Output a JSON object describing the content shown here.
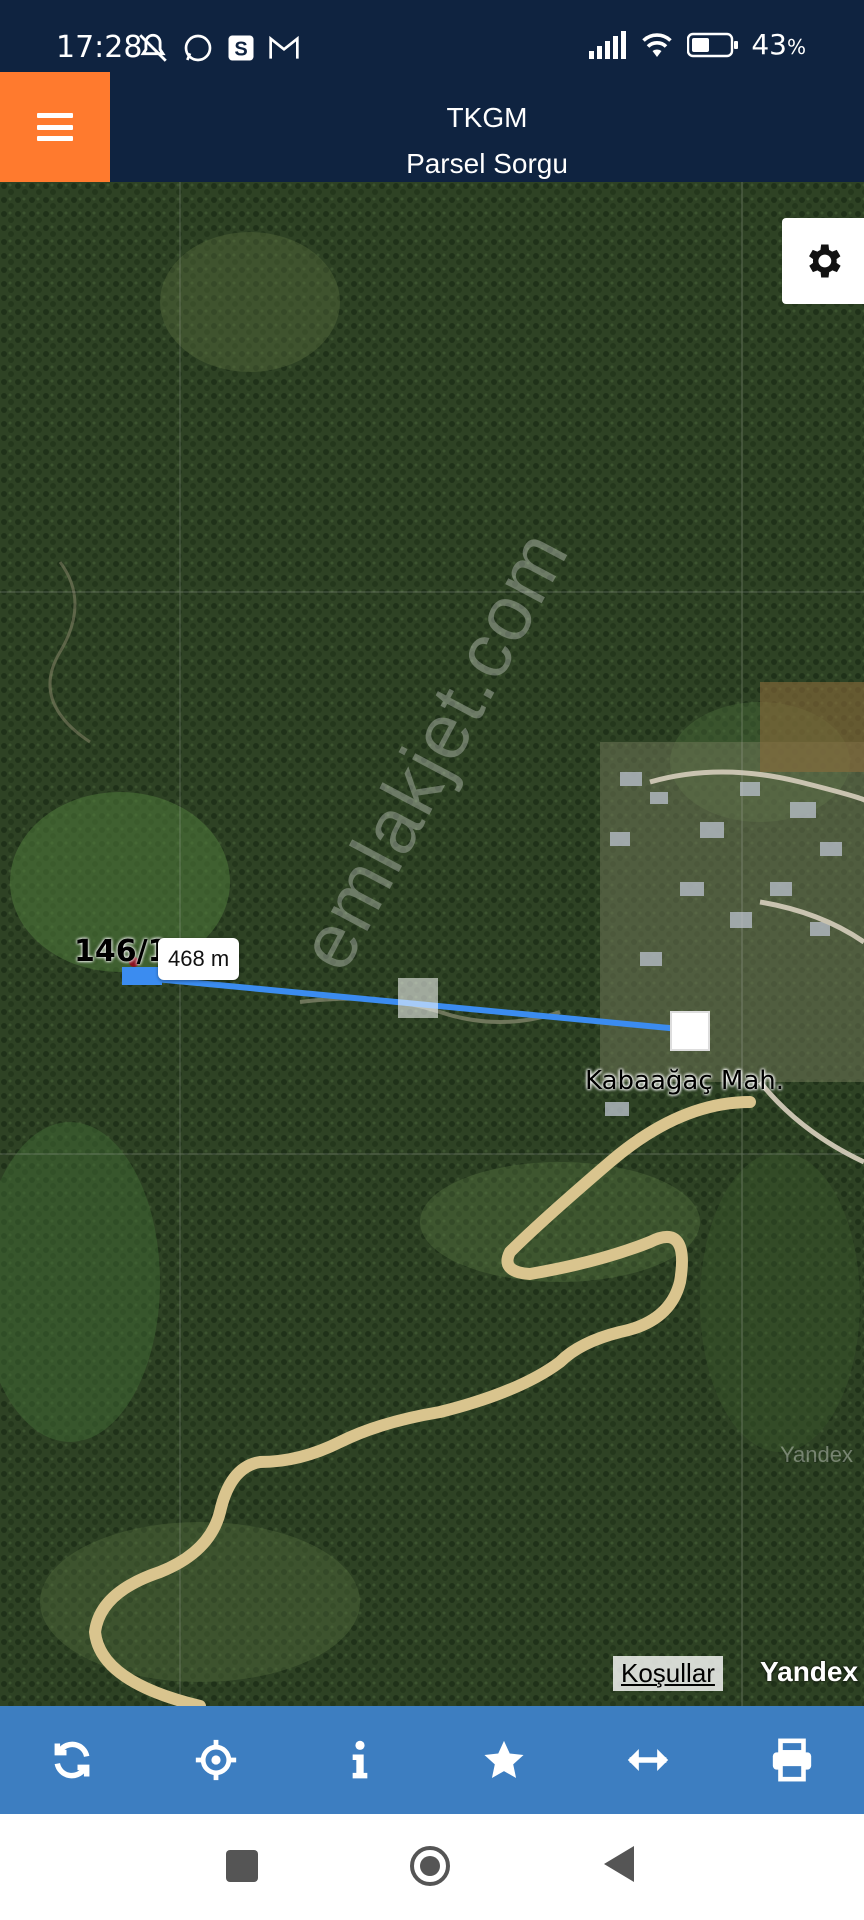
{
  "status_bar": {
    "time": "17:28",
    "battery": "43",
    "battery_unit": "%"
  },
  "header": {
    "title": "TKGM",
    "subtitle": "Parsel Sorgu"
  },
  "map": {
    "parcel_label": "146/1",
    "distance_label": "468 m",
    "place_label": "Kabaağaç Mah.",
    "watermark": "emlakjet.com",
    "tile_watermark": "Yandex",
    "terms_link": "Koşullar",
    "provider": "Yandex"
  },
  "toolbar": {
    "items": [
      {
        "icon": "refresh-icon"
      },
      {
        "icon": "locate-icon"
      },
      {
        "icon": "info-icon"
      },
      {
        "icon": "star-icon"
      },
      {
        "icon": "measure-icon"
      },
      {
        "icon": "print-icon"
      }
    ]
  },
  "colors": {
    "header_bg": "#0f2340",
    "menu_bg": "#ff7a2e",
    "toolbar_bg": "#3d7ec1",
    "measure_line": "#3b8cf0"
  }
}
